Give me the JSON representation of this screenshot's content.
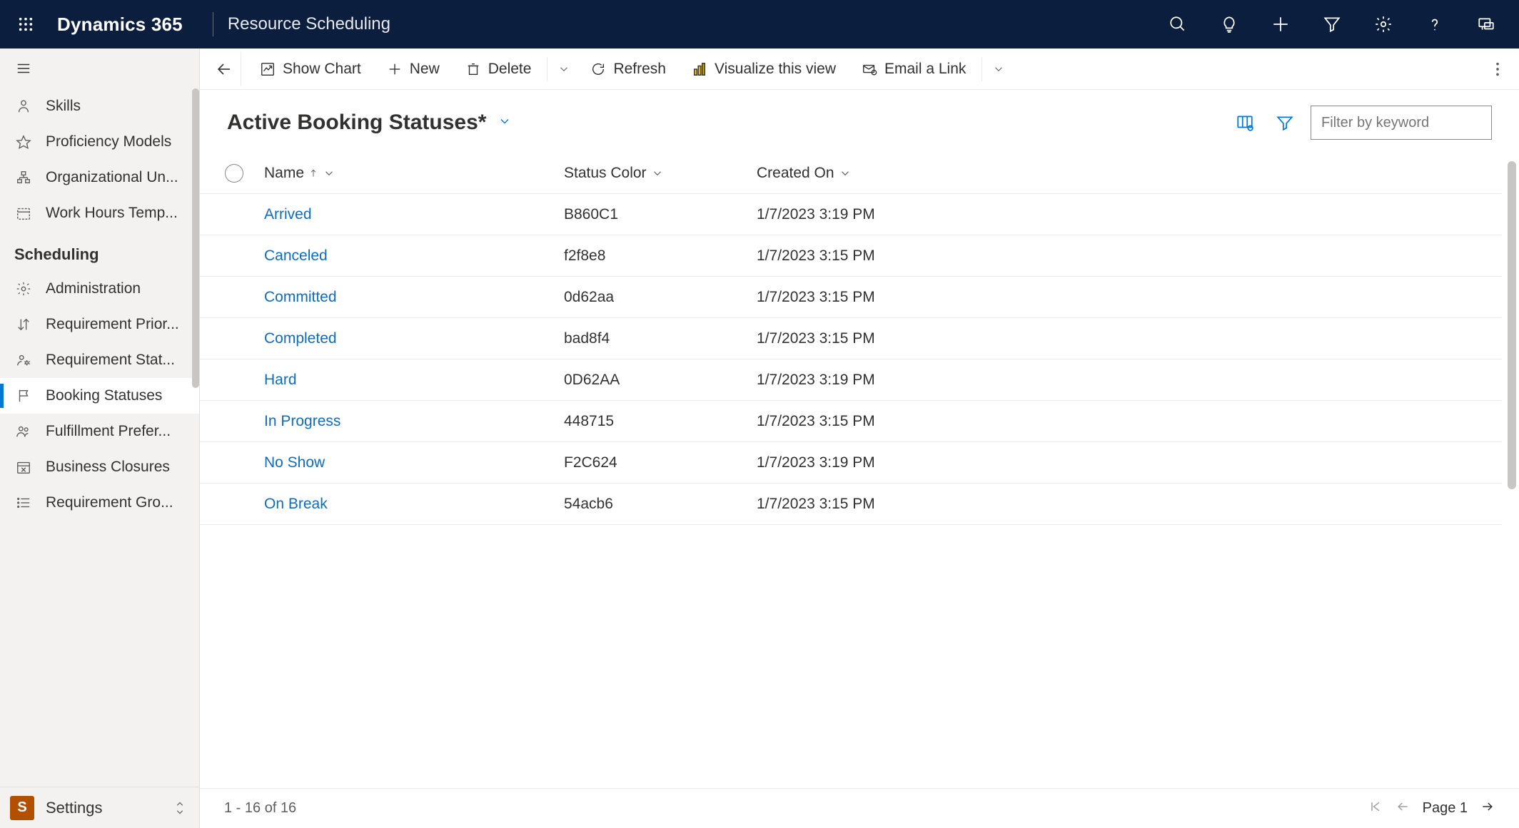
{
  "header": {
    "brand": "Dynamics 365",
    "app_name": "Resource Scheduling"
  },
  "sidebar": {
    "top_items": [
      {
        "icon": "skills",
        "label": "Skills"
      },
      {
        "icon": "star",
        "label": "Proficiency Models"
      },
      {
        "icon": "org",
        "label": "Organizational Un..."
      },
      {
        "icon": "calendar-dotted",
        "label": "Work Hours Temp..."
      }
    ],
    "group_title": "Scheduling",
    "group_items": [
      {
        "icon": "gear",
        "label": "Administration",
        "selected": false
      },
      {
        "icon": "arrows-ud",
        "label": "Requirement Prior...",
        "selected": false
      },
      {
        "icon": "person-gear",
        "label": "Requirement Stat...",
        "selected": false
      },
      {
        "icon": "flag",
        "label": "Booking Statuses",
        "selected": true
      },
      {
        "icon": "people",
        "label": "Fulfillment Prefer...",
        "selected": false
      },
      {
        "icon": "calendar-x",
        "label": "Business Closures",
        "selected": false
      },
      {
        "icon": "list",
        "label": "Requirement Gro...",
        "selected": false
      }
    ],
    "footer": {
      "badge": "S",
      "label": "Settings"
    }
  },
  "commands": {
    "show_chart": "Show Chart",
    "new": "New",
    "delete": "Delete",
    "refresh": "Refresh",
    "visualize": "Visualize this view",
    "email_link": "Email a Link"
  },
  "view": {
    "title": "Active Booking Statuses*",
    "filter_placeholder": "Filter by keyword"
  },
  "columns": {
    "name": "Name",
    "status_color": "Status Color",
    "created_on": "Created On"
  },
  "rows": [
    {
      "name": "Arrived",
      "status_color": "B860C1",
      "created_on": "1/7/2023 3:19 PM"
    },
    {
      "name": "Canceled",
      "status_color": "f2f8e8",
      "created_on": "1/7/2023 3:15 PM"
    },
    {
      "name": "Committed",
      "status_color": "0d62aa",
      "created_on": "1/7/2023 3:15 PM"
    },
    {
      "name": "Completed",
      "status_color": "bad8f4",
      "created_on": "1/7/2023 3:15 PM"
    },
    {
      "name": "Hard",
      "status_color": "0D62AA",
      "created_on": "1/7/2023 3:19 PM"
    },
    {
      "name": "In Progress",
      "status_color": "448715",
      "created_on": "1/7/2023 3:15 PM"
    },
    {
      "name": "No Show",
      "status_color": "F2C624",
      "created_on": "1/7/2023 3:19 PM"
    },
    {
      "name": "On Break",
      "status_color": "54acb6",
      "created_on": "1/7/2023 3:15 PM"
    }
  ],
  "status": {
    "count_label": "1 - 16 of 16",
    "page_label": "Page 1"
  }
}
